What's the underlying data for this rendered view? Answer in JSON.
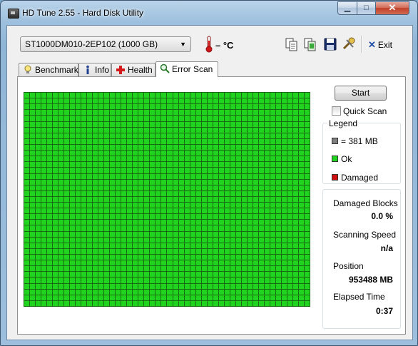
{
  "window": {
    "title": "HD Tune 2.55 - Hard Disk Utility"
  },
  "toolbar": {
    "drive": "ST1000DM010-2EP102 (1000 GB)",
    "temperature": "– °C",
    "exit_label": "Exit"
  },
  "tabs": [
    {
      "label": "Benchmark",
      "icon": "benchmark-icon"
    },
    {
      "label": "Info",
      "icon": "info-icon"
    },
    {
      "label": "Health",
      "icon": "health-icon"
    },
    {
      "label": "Error Scan",
      "icon": "error-scan-icon",
      "active": true
    }
  ],
  "scan": {
    "start_label": "Start",
    "quick_scan_label": "Quick Scan",
    "quick_scan_checked": false,
    "legend": {
      "title": "Legend",
      "items": [
        {
          "label": "= 381 MB",
          "color": "#7f7f7f"
        },
        {
          "label": "Ok",
          "color": "#1fd31f"
        },
        {
          "label": "Damaged",
          "color": "#d01010"
        }
      ]
    },
    "stats": {
      "damaged_blocks_label": "Damaged Blocks",
      "damaged_blocks_value": "0.0 %",
      "scanning_speed_label": "Scanning Speed",
      "scanning_speed_value": "n/a",
      "position_label": "Position",
      "position_value": "953488 MB",
      "elapsed_label": "Elapsed Time",
      "elapsed_value": "0:37"
    }
  },
  "colors": {
    "ok": "#1fd31f",
    "grid_line": "#1c6a14"
  }
}
